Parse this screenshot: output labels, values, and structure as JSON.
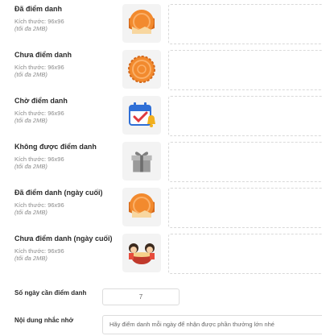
{
  "icon_rows": [
    {
      "title": "Đã điểm danh",
      "size": "Kích thước: 96x96",
      "note": "(tối đa 2MB)",
      "icon": "mooncake-icon"
    },
    {
      "title": "Chưa điểm danh",
      "size": "Kích thước: 96x96",
      "note": "(tối đa 2MB)",
      "icon": "mooncake-icon"
    },
    {
      "title": "Chờ điểm danh",
      "size": "Kích thước: 96x96",
      "note": "(tối đa 2MB)",
      "icon": "calendar-bell-icon"
    },
    {
      "title": "Không được điểm danh",
      "size": "Kích thước: 96x96",
      "note": "(tối đa 2MB)",
      "icon": "gift-box-icon"
    },
    {
      "title": "Đã điểm danh (ngày cuối)",
      "size": "Kích thước: 96x96",
      "note": "(tối đa 2MB)",
      "icon": "mooncake-icon"
    },
    {
      "title": "Chưa điểm danh (ngày cuối)",
      "size": "Kích thước: 96x96",
      "note": "(tối đa 2MB)",
      "icon": "kids-eating-icon"
    }
  ],
  "days_field": {
    "label": "Số ngày cần điểm danh",
    "value": "7"
  },
  "reminder_field": {
    "label": "Nội dung nhắc nhở",
    "value": "Hãy điểm danh mỗi ngày để nhận được phần thưởng lớn nhé"
  },
  "colors": {
    "mooncake": "#f28a2e",
    "mooncake_dark": "#d4681a",
    "calendar_blue": "#2f6fd6",
    "calendar_red": "#e0393e",
    "bell": "#f2b01e"
  }
}
